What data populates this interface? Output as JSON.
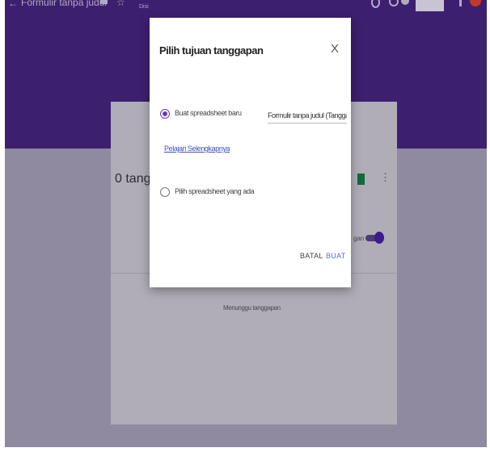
{
  "topbar": {
    "back_glyph": "←",
    "form_title": "Formulir tanpa judul",
    "saved_text": "Disi"
  },
  "card": {
    "response_count": "0 tangg",
    "waiting_text": "Menunggu tanggapan",
    "accepting_partial": "gan"
  },
  "dialog": {
    "title": "Pilih tujuan tanggapan",
    "close_glyph": "X",
    "option_new": "Buat spreadsheet baru",
    "new_sheet_name": "Formulir tanpa judul (Tangga",
    "learn_more": "Pelajari Selengkapnya",
    "option_existing": "Pilih spreadsheet yang ada",
    "cancel_label": "BATAL",
    "create_label": "BUAT"
  },
  "colors": {
    "header": "#3d1f6f",
    "accent": "#673ab7",
    "sheets_green": "#0f9d58"
  }
}
